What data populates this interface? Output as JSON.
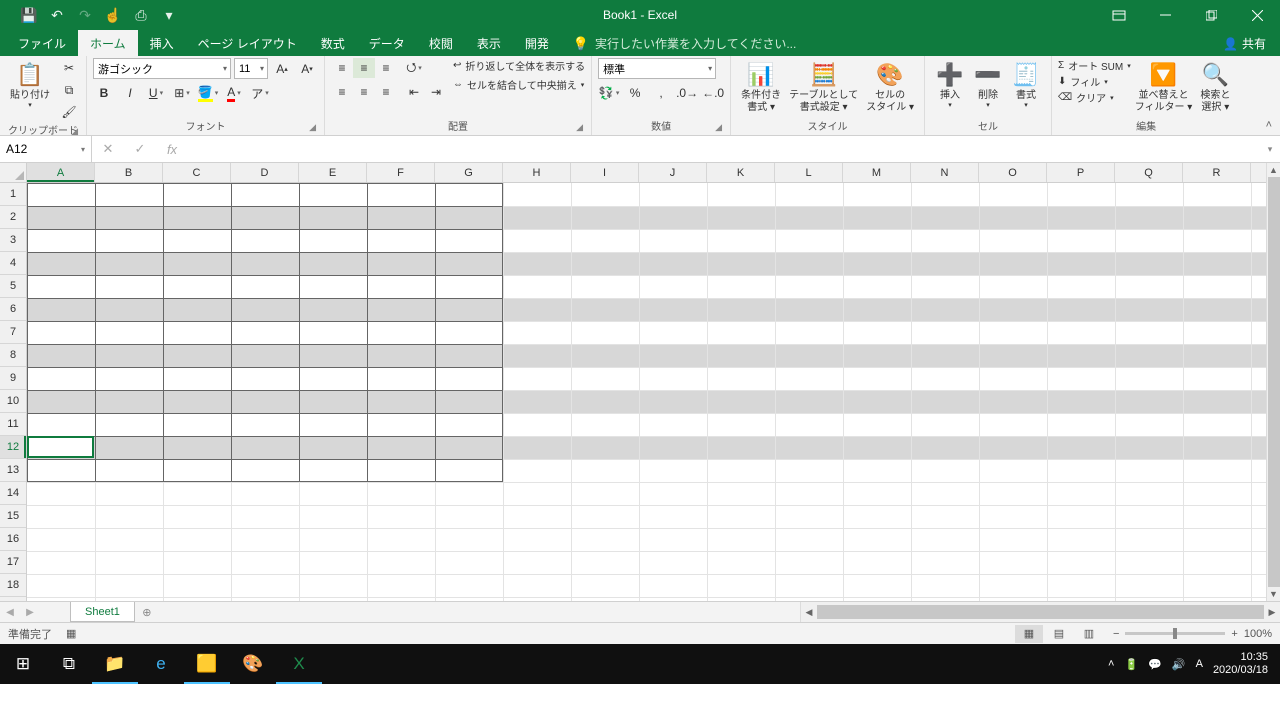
{
  "title": "Book1 - Excel",
  "qat": {
    "save": "💾",
    "undo": "↶",
    "redo": "↷",
    "touch": "☝",
    "quick": "⎙"
  },
  "tabs": [
    "ファイル",
    "ホーム",
    "挿入",
    "ページ レイアウト",
    "数式",
    "データ",
    "校閲",
    "表示",
    "開発"
  ],
  "active_tab": 1,
  "tellme": "実行したい作業を入力してください...",
  "share": "共有",
  "groups": {
    "clipboard": {
      "title": "クリップボード",
      "paste": "貼り付け"
    },
    "font": {
      "title": "フォント",
      "name": "游ゴシック",
      "size": "11"
    },
    "alignment": {
      "title": "配置",
      "wrap": "折り返して全体を表示する",
      "merge": "セルを結合して中央揃え"
    },
    "number": {
      "title": "数値",
      "format": "標準"
    },
    "styles": {
      "title": "スタイル",
      "cond": "条件付き\n書式 ▾",
      "table": "テーブルとして\n書式設定 ▾",
      "cell": "セルの\nスタイル ▾"
    },
    "cells": {
      "title": "セル",
      "insert": "挿入",
      "delete": "削除",
      "format": "書式"
    },
    "editing": {
      "title": "編集",
      "sum": "オート SUM",
      "fill": "フィル",
      "clear": "クリア",
      "sort": "並べ替えと\nフィルター ▾",
      "find": "検索と\n選択 ▾"
    }
  },
  "namebox": "A12",
  "formula": "",
  "columns": [
    "A",
    "B",
    "C",
    "D",
    "E",
    "F",
    "G",
    "H",
    "I",
    "J",
    "K",
    "L",
    "M",
    "N",
    "O",
    "P",
    "Q",
    "R"
  ],
  "rows": [
    1,
    2,
    3,
    4,
    5,
    6,
    7,
    8,
    9,
    10,
    11,
    12,
    13,
    14,
    15,
    16,
    17,
    18
  ],
  "striped_rows": [
    2,
    4,
    6,
    8,
    10,
    12
  ],
  "bordered_region": {
    "row0": 1,
    "row1": 13,
    "cols": 7
  },
  "active": {
    "col": 0,
    "row": 11
  },
  "sheet_tab": "Sheet1",
  "status": {
    "ready": "準備完了",
    "zoom": "100%"
  },
  "tray": {
    "time": "10:35",
    "date": "2020/03/18",
    "ime": "A"
  }
}
